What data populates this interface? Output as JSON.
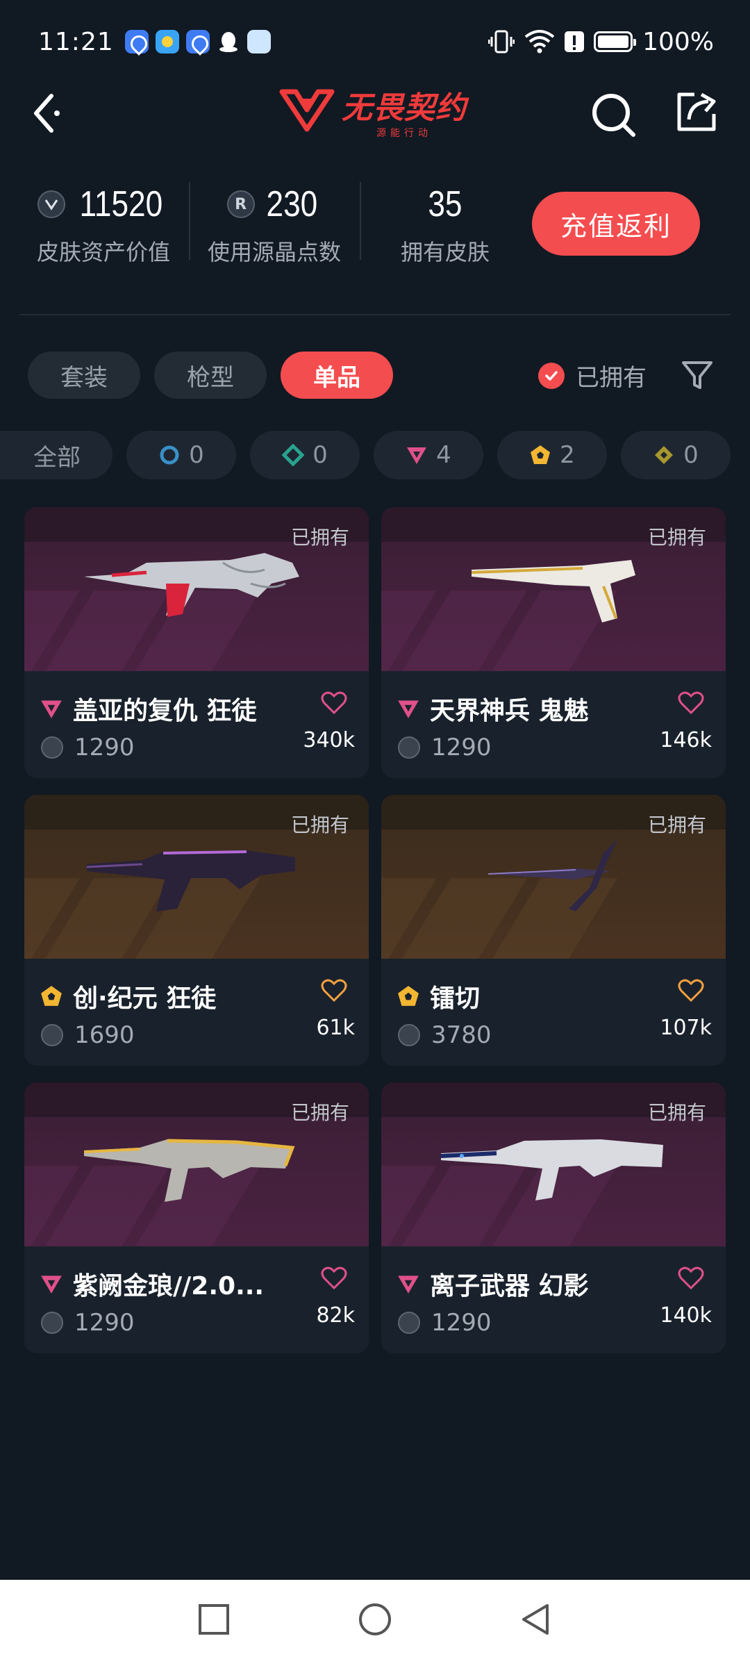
{
  "status_bar": {
    "time": "11:21",
    "battery_text": "100%",
    "icons": [
      "app-notification-icon",
      "weather-icon",
      "app-notification-icon",
      "qq-icon",
      "bot-icon",
      "vibrate-icon",
      "wifi-icon",
      "alert-icon",
      "battery-icon"
    ]
  },
  "header": {
    "logo_title": "无畏契约",
    "logo_subtitle": "源能行动"
  },
  "stats": {
    "asset_value": "11520",
    "asset_label": "皮肤资产价值",
    "points_value": "230",
    "points_label": "使用源晶点数",
    "points_icon_letter": "R",
    "skins_value": "35",
    "skins_label": "拥有皮肤",
    "recharge_label": "充值返利"
  },
  "tabs": [
    {
      "label": "套装",
      "active": false
    },
    {
      "label": "枪型",
      "active": false
    },
    {
      "label": "单品",
      "active": true
    }
  ],
  "owned_filter_label": "已拥有",
  "rarity_chips": [
    {
      "label": "全部",
      "count": "",
      "color": ""
    },
    {
      "label": "",
      "count": "0",
      "color": "#3a90c8"
    },
    {
      "label": "",
      "count": "0",
      "color": "#2aa38e"
    },
    {
      "label": "",
      "count": "4",
      "color": "#e0508a"
    },
    {
      "label": "",
      "count": "2",
      "color": "#f2b632"
    },
    {
      "label": "",
      "count": "0",
      "color": "#a7972e"
    }
  ],
  "cards": [
    {
      "name": "盖亚的复仇 狂徒",
      "price": "1290",
      "likes": "340k",
      "owned": "已拥有",
      "rarity": "premium",
      "theme": "purple"
    },
    {
      "name": "天界神兵 鬼魅",
      "price": "1290",
      "likes": "146k",
      "owned": "已拥有",
      "rarity": "premium",
      "theme": "purple"
    },
    {
      "name": "创·纪元 狂徒",
      "price": "1690",
      "likes": "61k",
      "owned": "已拥有",
      "rarity": "exclusive",
      "theme": "gold"
    },
    {
      "name": "镭切",
      "price": "3780",
      "likes": "107k",
      "owned": "已拥有",
      "rarity": "exclusive",
      "theme": "gold"
    },
    {
      "name": "紫阙金琅//2.0...",
      "price": "1290",
      "likes": "82k",
      "owned": "已拥有",
      "rarity": "premium",
      "theme": "purple"
    },
    {
      "name": "离子武器 幻影",
      "price": "1290",
      "likes": "140k",
      "owned": "已拥有",
      "rarity": "premium",
      "theme": "purple"
    }
  ],
  "colors": {
    "accent": "#f44d4f",
    "background": "#111923",
    "card": "#19222c",
    "premium": "#e0508a",
    "exclusive": "#f2b632"
  }
}
